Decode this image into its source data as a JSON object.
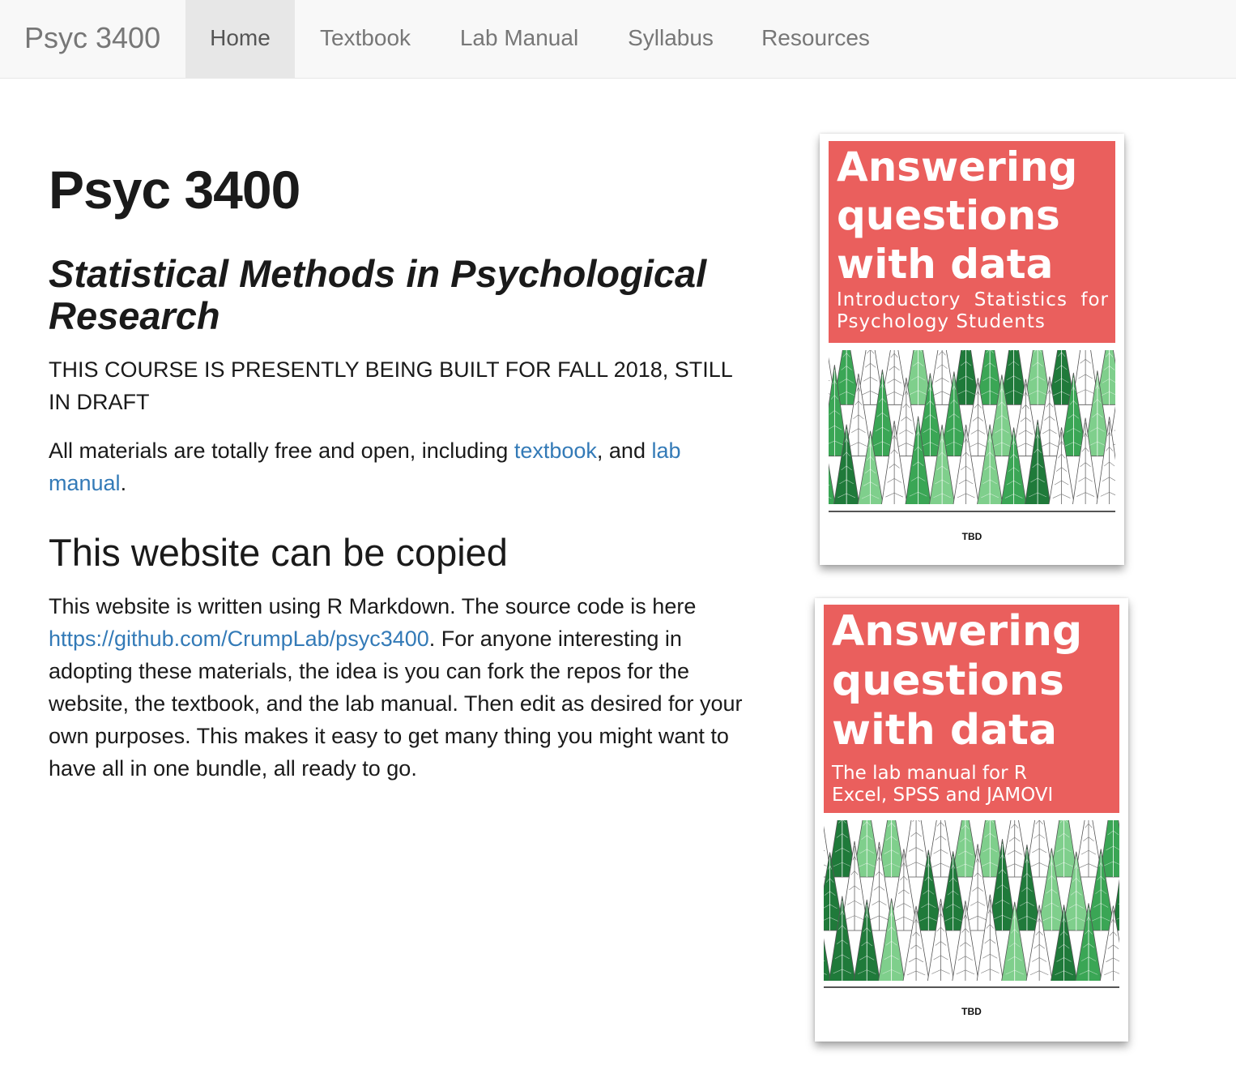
{
  "navbar": {
    "brand": "Psyc 3400",
    "items": [
      {
        "label": "Home",
        "active": true
      },
      {
        "label": "Textbook",
        "active": false
      },
      {
        "label": "Lab Manual",
        "active": false
      },
      {
        "label": "Syllabus",
        "active": false
      },
      {
        "label": "Resources",
        "active": false
      }
    ]
  },
  "main": {
    "title": "Psyc 3400",
    "subtitle": "Statistical Methods in Psychological Research",
    "notice": "THIS COURSE IS PRESENTLY BEING BUILT FOR FALL 2018, STILL IN DRAFT",
    "materials": {
      "prefix": "All materials are totally free and open, including ",
      "textbook_link": "textbook",
      "middle": ", and ",
      "lab_link": "lab manual",
      "suffix": "."
    },
    "section_heading": "This website can be copied",
    "copy": {
      "prefix": "This website is written using R Markdown. The source code is here ",
      "repo_link": "https://github.com/CrumpLab/psyc3400",
      "suffix": ". For anyone interesting in adopting these materials, the idea is you can fork the repos for the website, the textbook, and the lab manual. Then edit as desired for your own purposes. This makes it easy to get many thing you might want to have all in one bundle, all ready to go."
    }
  },
  "books": [
    {
      "title_line1": "Answering",
      "title_line2": "questions",
      "title_line3": "with data",
      "subtitle": "Introductory Statistics for Psychology Students",
      "footer": "TBD"
    },
    {
      "title_line1": "Answering",
      "title_line2": "questions",
      "title_line3": "with data",
      "subtitle_line1": "The lab manual for R",
      "subtitle_line2": "Excel, SPSS and JAMOVI",
      "footer": "TBD"
    }
  ],
  "colors": {
    "cover_red": "#ea5f5d",
    "link_blue": "#337ab7",
    "navbar_bg": "#f8f8f8",
    "active_nav_bg": "#e7e7e7",
    "tree_dark": "#1f7a3a",
    "tree_mid": "#3aa655",
    "tree_light": "#7fcf8c"
  }
}
